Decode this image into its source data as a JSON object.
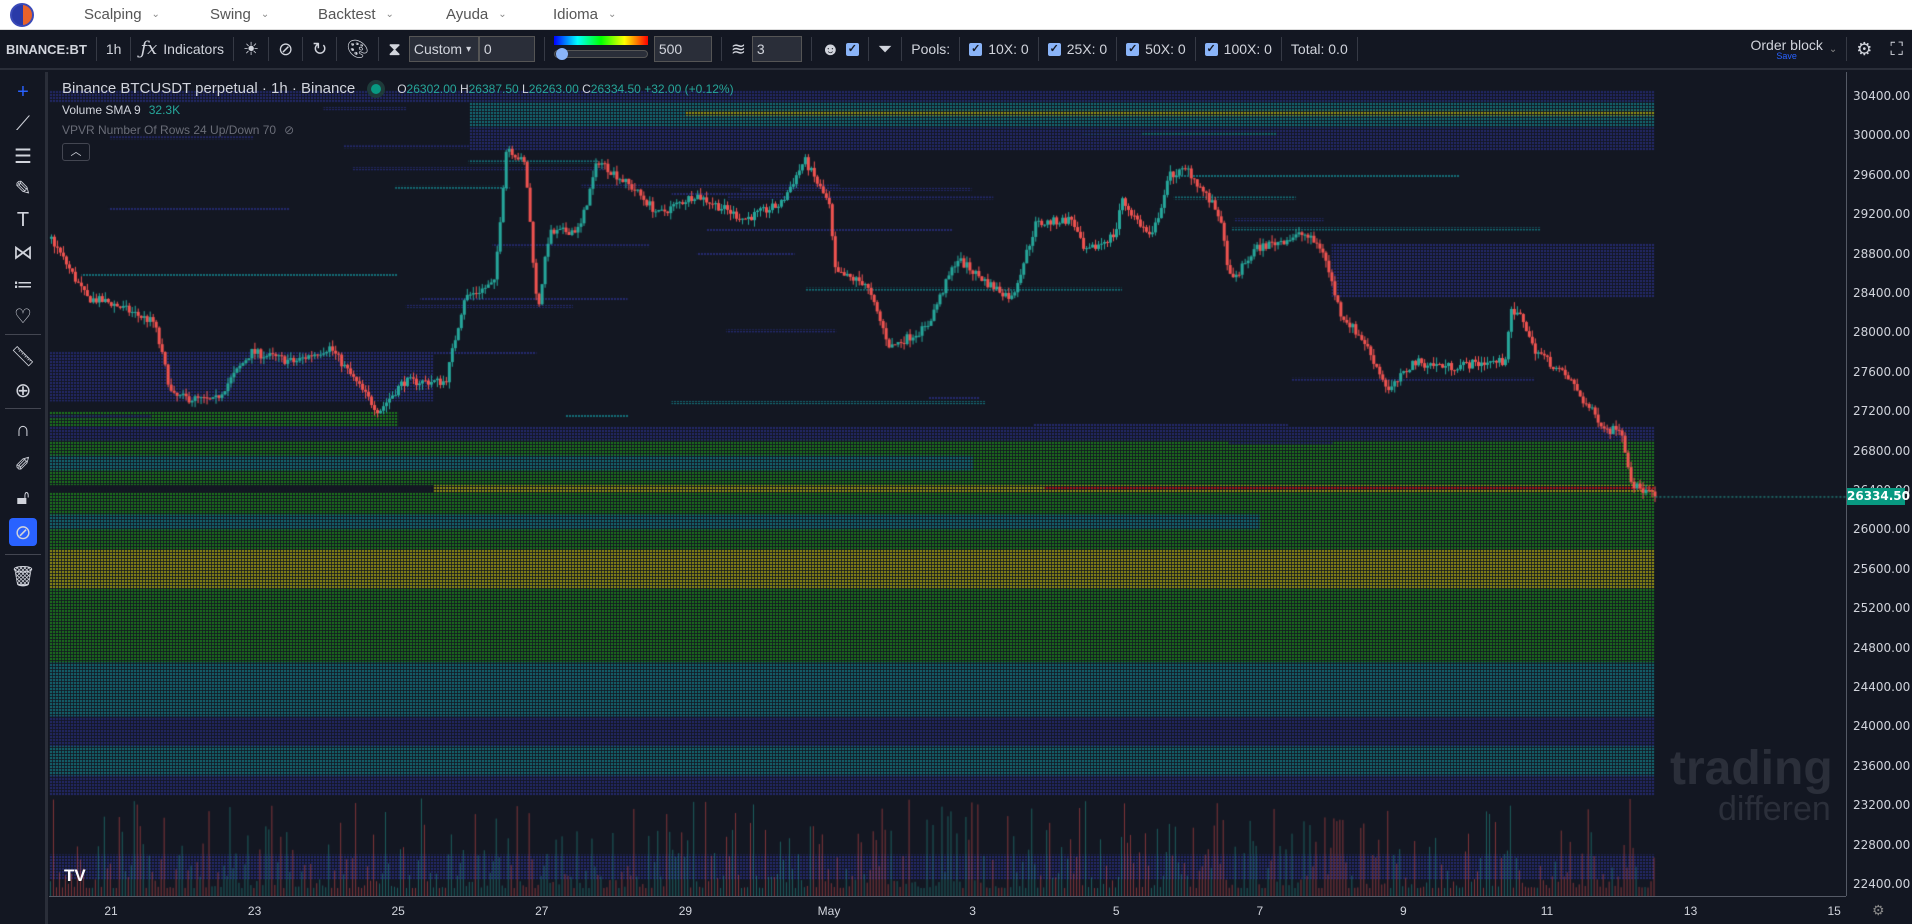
{
  "nav": {
    "items": [
      {
        "label": "Scalping"
      },
      {
        "label": "Swing"
      },
      {
        "label": "Backtest"
      },
      {
        "label": "Ayuda"
      },
      {
        "label": "Idioma"
      }
    ]
  },
  "toolbar": {
    "symbol": "BINANCE:BT",
    "interval": "1h",
    "indicators": "Indicators",
    "mode_select": "Custom",
    "mode_value": "0",
    "gradient_value": "500",
    "layers_value": "3",
    "pools_label": "Pools:",
    "pools": [
      {
        "label": "10X: 0",
        "checked": true
      },
      {
        "label": "25X: 0",
        "checked": true
      },
      {
        "label": "50X: 0",
        "checked": true
      },
      {
        "label": "100X: 0",
        "checked": true
      }
    ],
    "total": "Total: 0.0",
    "order_block": "Order block",
    "save": "Save"
  },
  "legend": {
    "title": "Binance BTCUSDT perpetual · 1h · Binance",
    "o_label": "O",
    "o": "26302.00",
    "h_label": "H",
    "h": "26387.50",
    "l_label": "L",
    "l": "26263.00",
    "c_label": "C",
    "c": "26334.50",
    "change": "+32.00 (+0.12%)",
    "volume_label": "Volume SMA 9",
    "volume_value": "32.3K",
    "vpvr": "VPVR Number Of Rows 24 Up/Down 70"
  },
  "watermark": {
    "line1": "trading",
    "line2": "differen"
  },
  "current_price": "26334.50",
  "colors": {
    "up": "#26a69a",
    "down": "#ef5350",
    "accent": "#2962ff"
  },
  "chart_data": {
    "type": "candlestick",
    "interval": "1h",
    "price_ticks": [
      "30400.00",
      "30000.00",
      "29600.00",
      "29200.00",
      "28800.00",
      "28400.00",
      "28000.00",
      "27600.00",
      "27200.00",
      "26800.00",
      "26400.00",
      "26000.00",
      "25600.00",
      "25200.00",
      "24800.00",
      "24400.00",
      "24000.00",
      "23600.00",
      "23200.00",
      "22800.00",
      "22400.00"
    ],
    "ylim": [
      22400,
      30400
    ],
    "date_ticks": [
      "21",
      "23",
      "25",
      "27",
      "29",
      "May",
      "3",
      "5",
      "7",
      "9",
      "11",
      "13",
      "15"
    ],
    "close_path_days_from_apr21": [
      [
        -0.85,
        28950
      ],
      [
        -0.36,
        28350
      ],
      [
        -0.02,
        28300
      ],
      [
        0.58,
        28100
      ],
      [
        0.83,
        27350
      ],
      [
        1.42,
        27300
      ],
      [
        1.93,
        27800
      ],
      [
        2.53,
        27700
      ],
      [
        3.03,
        27850
      ],
      [
        3.54,
        27350
      ],
      [
        3.71,
        27200
      ],
      [
        4.05,
        27500
      ],
      [
        4.64,
        27500
      ],
      [
        4.9,
        28350
      ],
      [
        5.32,
        28500
      ],
      [
        5.49,
        29900
      ],
      [
        5.75,
        29700
      ],
      [
        5.92,
        28200
      ],
      [
        6.08,
        29000
      ],
      [
        6.51,
        29050
      ],
      [
        6.76,
        29750
      ],
      [
        7.27,
        29450
      ],
      [
        7.61,
        29200
      ],
      [
        8.12,
        29400
      ],
      [
        8.8,
        29150
      ],
      [
        9.31,
        29300
      ],
      [
        9.64,
        29750
      ],
      [
        9.98,
        29300
      ],
      [
        10.07,
        28600
      ],
      [
        10.49,
        28500
      ],
      [
        10.83,
        27850
      ],
      [
        11.34,
        28050
      ],
      [
        11.76,
        28750
      ],
      [
        12.19,
        28500
      ],
      [
        12.53,
        28350
      ],
      [
        12.86,
        29100
      ],
      [
        13.37,
        29150
      ],
      [
        13.54,
        28800
      ],
      [
        13.97,
        29000
      ],
      [
        14.05,
        29350
      ],
      [
        14.47,
        28950
      ],
      [
        14.73,
        29600
      ],
      [
        14.98,
        29650
      ],
      [
        15.41,
        29200
      ],
      [
        15.58,
        28500
      ],
      [
        15.92,
        28850
      ],
      [
        16.59,
        29000
      ],
      [
        16.85,
        28850
      ],
      [
        17.1,
        28200
      ],
      [
        17.44,
        27900
      ],
      [
        17.78,
        27400
      ],
      [
        18.12,
        27700
      ],
      [
        18.63,
        27650
      ],
      [
        19.14,
        27700
      ],
      [
        19.39,
        27700
      ],
      [
        19.47,
        28200
      ],
      [
        19.64,
        28150
      ],
      [
        19.78,
        27850
      ],
      [
        20.32,
        27500
      ],
      [
        20.49,
        27300
      ],
      [
        20.83,
        27000
      ],
      [
        21.0,
        27050
      ],
      [
        21.17,
        26450
      ],
      [
        21.51,
        26334.5
      ]
    ],
    "heatmap_bands": [
      {
        "low": 30340,
        "high": 30450,
        "level": "navy",
        "from": -1,
        "to": 21.5
      },
      {
        "low": 30080,
        "high": 30340,
        "level": "teal",
        "from": 5,
        "to": 21.5
      },
      {
        "low": 30200,
        "high": 30250,
        "level": "yellow",
        "from": 8,
        "to": 21.5
      },
      {
        "low": 29850,
        "high": 30080,
        "level": "navy",
        "from": 5,
        "to": 21.5
      },
      {
        "low": 28350,
        "high": 28900,
        "level": "navy",
        "from": 17,
        "to": 21.5
      },
      {
        "low": 27300,
        "high": 27800,
        "level": "navy",
        "from": -1,
        "to": 4.5
      },
      {
        "low": 27050,
        "high": 27200,
        "level": "green",
        "from": -1,
        "to": 4
      },
      {
        "low": 26900,
        "high": 27050,
        "level": "navy",
        "from": -1,
        "to": 21.5
      },
      {
        "low": 26450,
        "high": 26900,
        "level": "green",
        "from": -1,
        "to": 21.5
      },
      {
        "low": 26600,
        "high": 26750,
        "level": "teal",
        "from": -1,
        "to": 12
      },
      {
        "low": 26380,
        "high": 26450,
        "level": "yellow",
        "from": 4.5,
        "to": 21.5
      },
      {
        "low": 26400,
        "high": 26440,
        "level": "red",
        "from": 13,
        "to": 21.5
      },
      {
        "low": 25800,
        "high": 26380,
        "level": "green",
        "from": -1,
        "to": 21.5
      },
      {
        "low": 26000,
        "high": 26150,
        "level": "teal",
        "from": -1,
        "to": 16
      },
      {
        "low": 25400,
        "high": 25800,
        "level": "yellow",
        "from": -1,
        "to": 21.5
      },
      {
        "low": 25250,
        "high": 25280,
        "level": "red",
        "from": 17,
        "to": 21.5
      },
      {
        "low": 24650,
        "high": 25400,
        "level": "green",
        "from": -1,
        "to": 21.5
      },
      {
        "low": 24100,
        "high": 24650,
        "level": "teal",
        "from": -1,
        "to": 21.5
      },
      {
        "low": 23300,
        "high": 24100,
        "level": "navy",
        "from": -1,
        "to": 21.5
      },
      {
        "low": 23500,
        "high": 23800,
        "level": "teal",
        "from": -1,
        "to": 21.5
      },
      {
        "low": 22450,
        "high": 22700,
        "level": "navy",
        "from": -1,
        "to": 21.5
      }
    ]
  }
}
